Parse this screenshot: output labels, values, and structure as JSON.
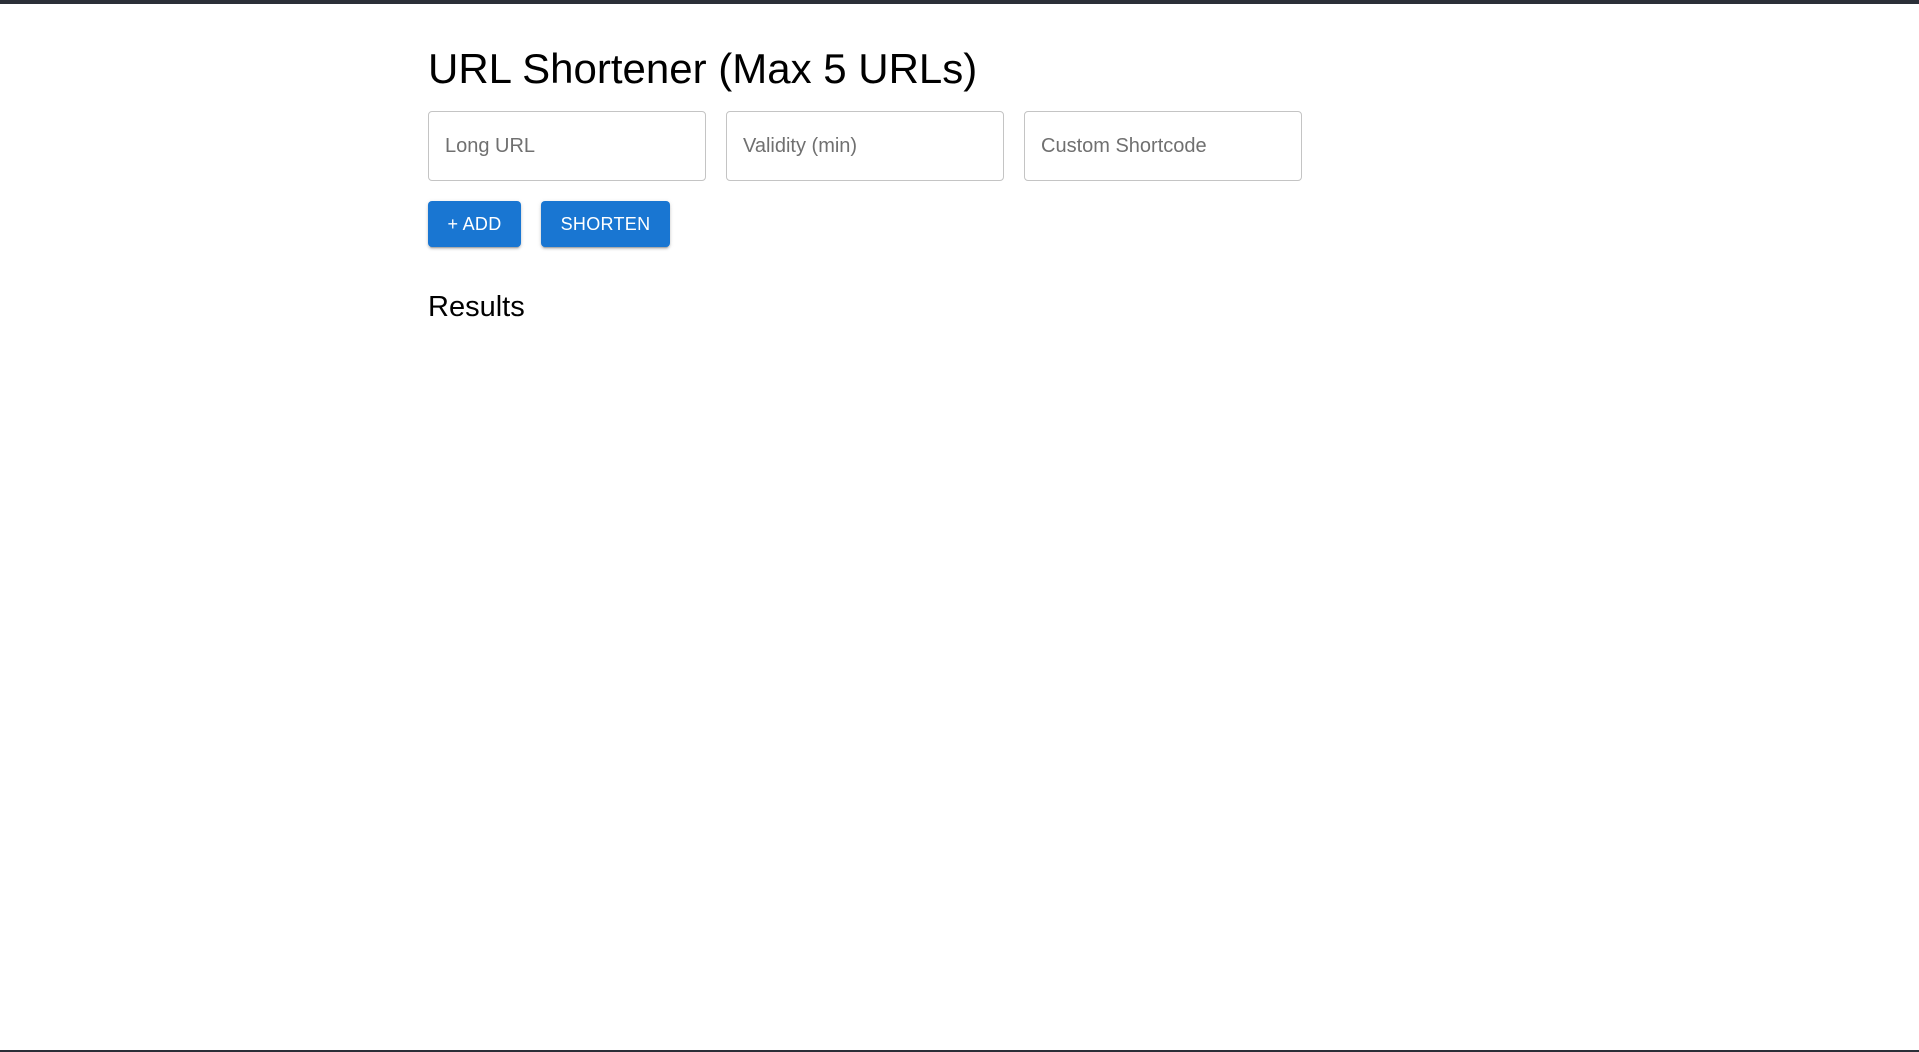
{
  "header": {
    "title": "URL Shortener (Max 5 URLs)"
  },
  "form": {
    "long_url": {
      "value": "",
      "placeholder": "Long URL"
    },
    "validity": {
      "value": "",
      "placeholder": "Validity (min)"
    },
    "shortcode": {
      "value": "",
      "placeholder": "Custom Shortcode"
    }
  },
  "actions": {
    "add_label": "+ ADD",
    "shorten_label": "SHORTEN"
  },
  "results": {
    "heading": "Results",
    "items": []
  },
  "colors": {
    "primary": "#1976d2",
    "window_frame": "#2b2f38",
    "field_border": "#c4c4c4"
  }
}
